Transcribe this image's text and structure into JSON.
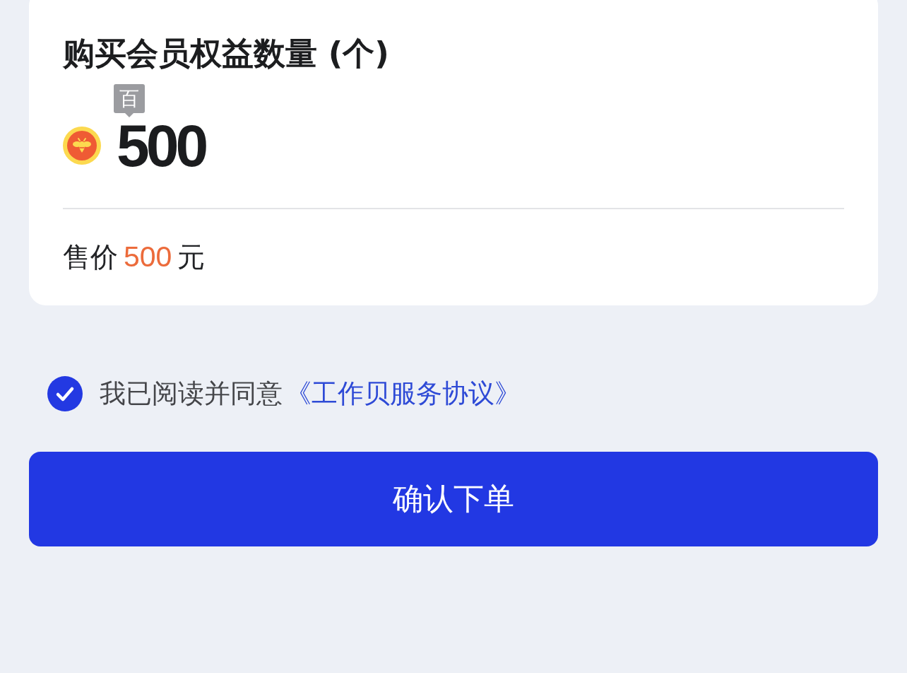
{
  "purchase_card": {
    "title": "购买会员权益数量 (个)",
    "digit_place": "百",
    "quantity": "500",
    "price": {
      "label": "售价",
      "amount": "500",
      "unit": "元"
    }
  },
  "agreement": {
    "checked": true,
    "text": "我已阅读并同意",
    "link": "《工作贝服务协议》"
  },
  "confirm_button": {
    "label": "确认下单"
  }
}
